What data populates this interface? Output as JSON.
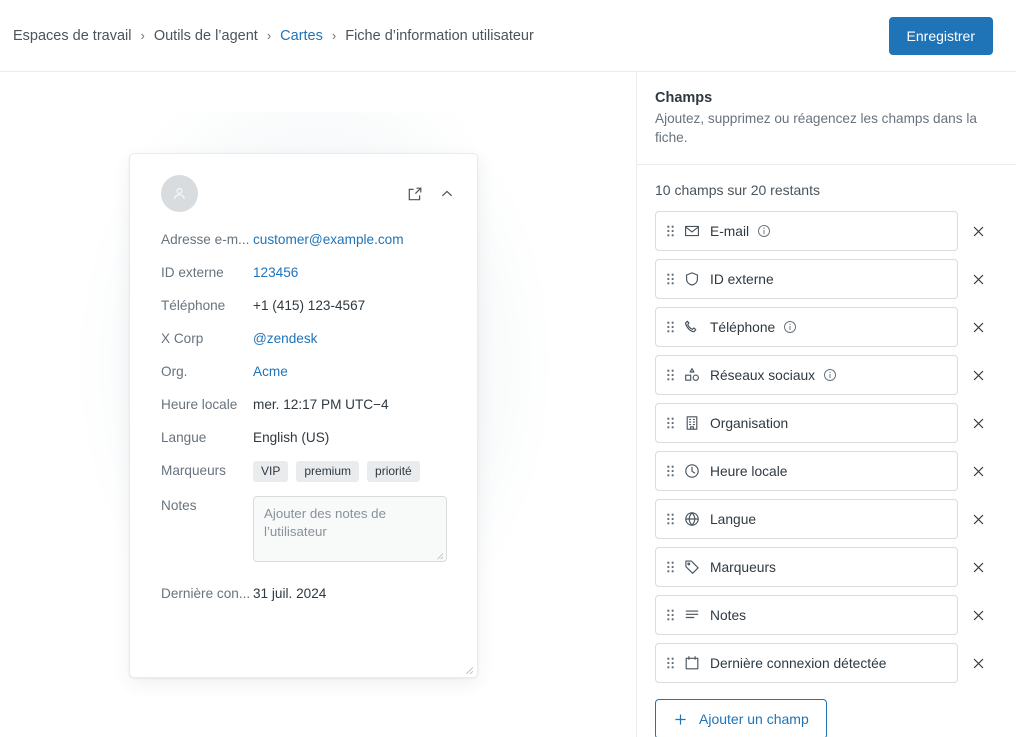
{
  "breadcrumb": {
    "items": [
      {
        "label": "Espaces de travail",
        "link": false
      },
      {
        "label": "Outils de l’agent",
        "link": false
      },
      {
        "label": "Cartes",
        "link": true
      },
      {
        "label": "Fiche d’information utilisateur",
        "link": false
      }
    ],
    "separator": "›"
  },
  "toolbar": {
    "save_label": "Enregistrer",
    "save_color": "#1f73b7"
  },
  "preview_card": {
    "avatar_icon": "user-avatar-icon",
    "open_icon": "external-link-icon",
    "collapse_icon": "chevron-up-icon",
    "rows": [
      {
        "label": "Adresse e-m...",
        "value": "customer@example.com",
        "style": "link"
      },
      {
        "label": "ID externe",
        "value": "123456",
        "style": "link"
      },
      {
        "label": "Téléphone",
        "value": "+1 (415) 123-4567",
        "style": "text"
      },
      {
        "label": "X Corp",
        "value": "@zendesk",
        "style": "link"
      },
      {
        "label": "Org.",
        "value": "Acme",
        "style": "link"
      },
      {
        "label": "Heure locale",
        "value": "mer. 12:17 PM UTC−4",
        "style": "text"
      },
      {
        "label": "Langue",
        "value": "English (US)",
        "style": "text"
      }
    ],
    "tags_row": {
      "label": "Marqueurs",
      "tags": [
        "VIP",
        "premium",
        "priorité"
      ]
    },
    "notes_row": {
      "label": "Notes",
      "placeholder": "Ajouter des notes de l’utilisateur",
      "value": ""
    },
    "last_row": {
      "label": "Dernière con...",
      "value": "31 juil. 2024"
    }
  },
  "panel": {
    "title": "Champs",
    "subtitle": "Ajoutez, supprimez ou réagencez les champs dans la fiche.",
    "count_text": "10 champs sur 20 restants",
    "remove_icon": "close-icon",
    "drag_icon": "drag-handle-icon",
    "info_icon": "info-circle-icon",
    "add_button": {
      "label": "Ajouter un champ",
      "icon": "plus-icon"
    },
    "fields": [
      {
        "label": "E-mail",
        "icon": "envelope-icon",
        "info": true
      },
      {
        "label": "ID externe",
        "icon": "shield-icon",
        "info": false
      },
      {
        "label": "Téléphone",
        "icon": "phone-icon",
        "info": true
      },
      {
        "label": "Réseaux sociaux",
        "icon": "shapes-icon",
        "info": true
      },
      {
        "label": "Organisation",
        "icon": "building-icon",
        "info": false
      },
      {
        "label": "Heure locale",
        "icon": "clock-icon",
        "info": false
      },
      {
        "label": "Langue",
        "icon": "globe-icon",
        "info": false
      },
      {
        "label": "Marqueurs",
        "icon": "tag-icon",
        "info": false
      },
      {
        "label": "Notes",
        "icon": "lines-icon",
        "info": false
      },
      {
        "label": "Dernière connexion détectée",
        "icon": "calendar-icon",
        "info": false
      }
    ]
  }
}
